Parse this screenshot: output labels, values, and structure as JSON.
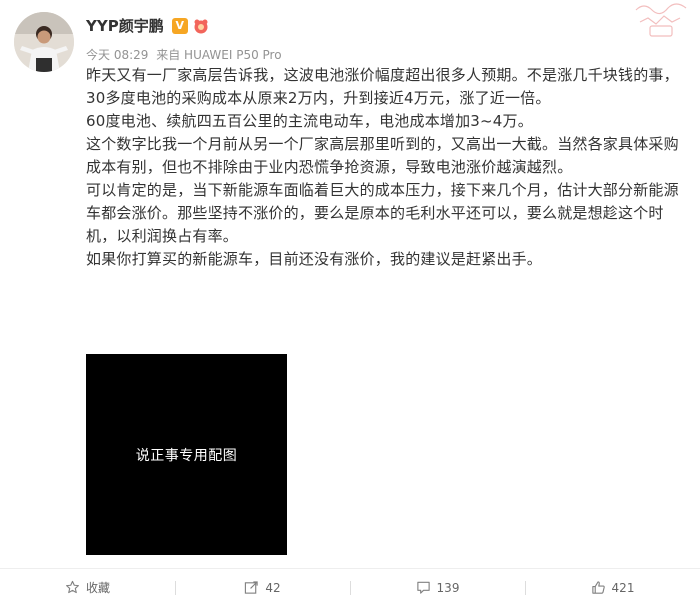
{
  "post": {
    "author": "YYP颜宇鹏",
    "verified_badge": "V",
    "time": "今天 08:29",
    "source": "来自 HUAWEI P50 Pro",
    "paragraphs": [
      "昨天又有一厂家高层告诉我，这波电池涨价幅度超出很多人预期。不是涨几千块钱的事，30多度电池的采购成本从原来2万内，升到接近4万元，涨了近一倍。",
      "60度电池、续航四五百公里的主流电动车，电池成本增加3~4万。",
      "这个数字比我一个月前从另一个厂家高层那里听到的，又高出一大截。当然各家具体采购成本有别，但也不排除由于业内恐慌争抢资源，导致电池涨价越演越烈。",
      "可以肯定的是，当下新能源车面临着巨大的成本压力，接下来几个月，估计大部分新能源车都会涨价。那些坚持不涨价的，要么是原本的毛利水平还可以，要么就是想趁这个时机，以利润换占有率。",
      "如果你打算买的新能源车，目前还没有涨价，我的建议是赶紧出手。"
    ],
    "image_caption": "说正事专用配图"
  },
  "actions": {
    "favorite_label": "收藏",
    "repost_count": "42",
    "comment_count": "139",
    "like_count": "421"
  },
  "colors": {
    "badge": "#f6a623",
    "meta_text": "#939393",
    "body_text": "#333333"
  }
}
